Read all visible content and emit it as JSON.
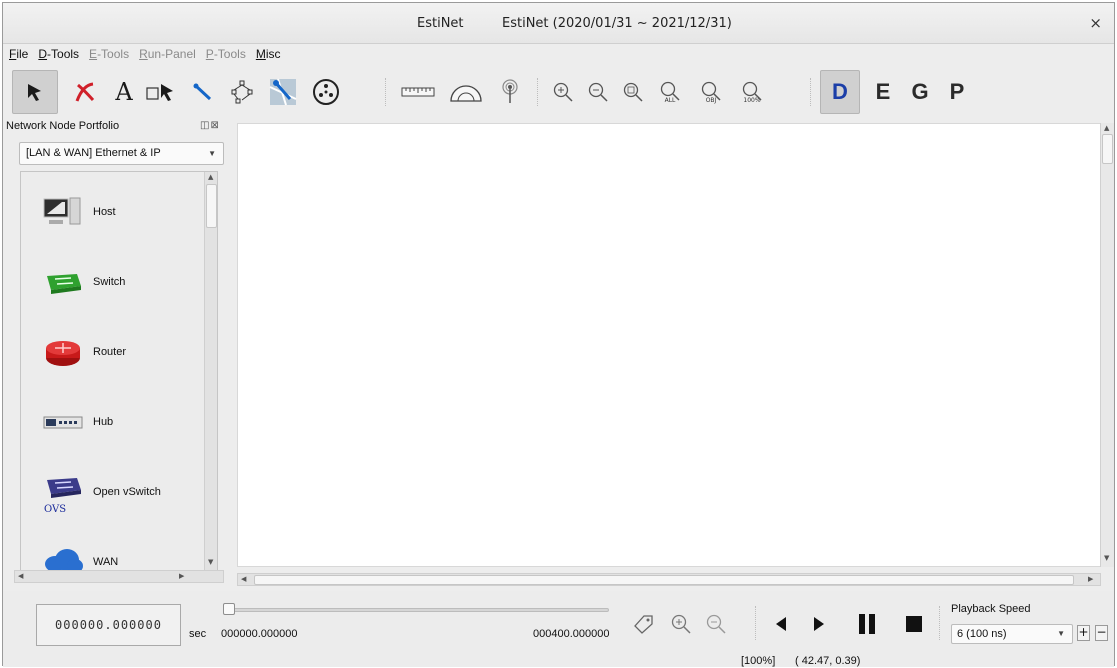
{
  "window": {
    "app_name": "EstiNet",
    "title": "EstiNet  (2020/01/31 ~ 2021/12/31)",
    "close_glyph": "×"
  },
  "menu": [
    {
      "first": "F",
      "rest": "ile",
      "enabled": true
    },
    {
      "first": "D",
      "rest": "-Tools",
      "enabled": true
    },
    {
      "first": "E",
      "rest": "-Tools",
      "enabled": false
    },
    {
      "first": "R",
      "rest": "un-Panel",
      "enabled": false
    },
    {
      "first": "P",
      "rest": "-Tools",
      "enabled": false
    },
    {
      "first": "M",
      "rest": "isc",
      "enabled": true
    }
  ],
  "toolbar": {
    "tools": [
      "select-arrow-icon",
      "delete-link-icon",
      "text-tool-icon",
      "rectangle-select-icon",
      "draw-link-icon",
      "auto-layout-icon",
      "map-icon",
      "node-group-icon",
      "ruler-icon",
      "protractor-icon",
      "antenna-icon",
      "zoom-in-icon",
      "zoom-out-icon",
      "zoom-fit-icon",
      "zoom-all-icon",
      "zoom-obj-icon",
      "zoom-100-icon"
    ],
    "text_tool_label": "A",
    "zoom_all_label": "ALL",
    "zoom_obj_label": "OBJ",
    "zoom_100_label": "100%",
    "modes": [
      "D",
      "E",
      "G",
      "P"
    ],
    "active_mode": "D",
    "accent": "#1b3ea8"
  },
  "left_panel": {
    "title": "Network Node Portfolio",
    "panel_buttons": "◫⊠",
    "category": "[LAN & WAN] Ethernet & IP",
    "items": [
      {
        "label": "Host",
        "icon": "host-icon"
      },
      {
        "label": "Switch",
        "icon": "switch-icon"
      },
      {
        "label": "Router",
        "icon": "router-icon"
      },
      {
        "label": "Hub",
        "icon": "hub-icon"
      },
      {
        "label": "Open vSwitch",
        "icon": "ovs-icon",
        "badge": "OVS"
      },
      {
        "label": "WAN",
        "icon": "wan-icon"
      }
    ]
  },
  "playback": {
    "current_time": "000000.000000",
    "unit": "sec",
    "start_time": "000000.000000",
    "end_time": "000400.000000",
    "progress": 0,
    "speed_label": "Playback Speed",
    "speed_value": "6 (100 ns)"
  },
  "status": {
    "zoom": "[100%]",
    "coords": "( 42.47, 0.39)"
  }
}
